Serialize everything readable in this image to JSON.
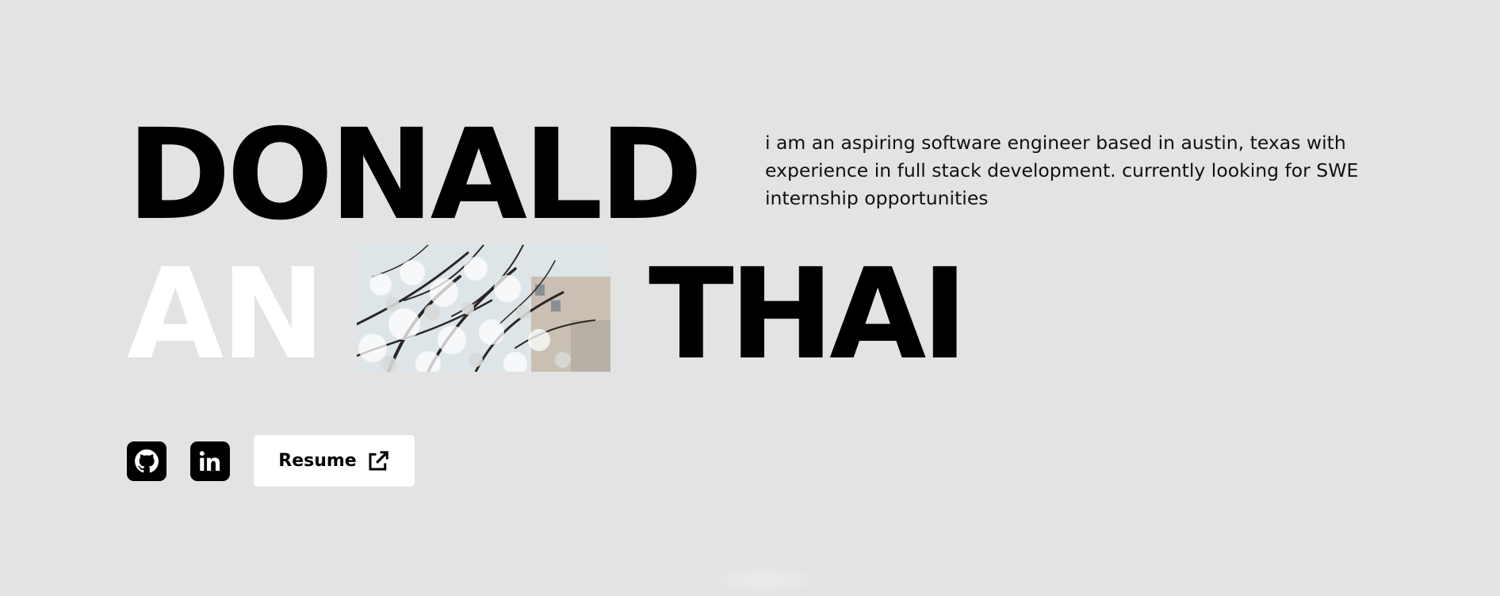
{
  "hero": {
    "name_first": "DONALD",
    "name_middle": "AN",
    "name_last": "THAI",
    "bio": "i am an aspiring software engineer based in austin, texas with experience in full stack development. currently looking for SWE internship opportunities"
  },
  "links": {
    "github_icon": "github-icon",
    "linkedin_icon": "linkedin-icon",
    "resume_label": "Resume",
    "resume_icon": "external-link-icon"
  },
  "colors": {
    "background": "#e3e3e3",
    "text": "#000000",
    "accent_name": "#ffffff",
    "button_bg": "#ffffff"
  }
}
